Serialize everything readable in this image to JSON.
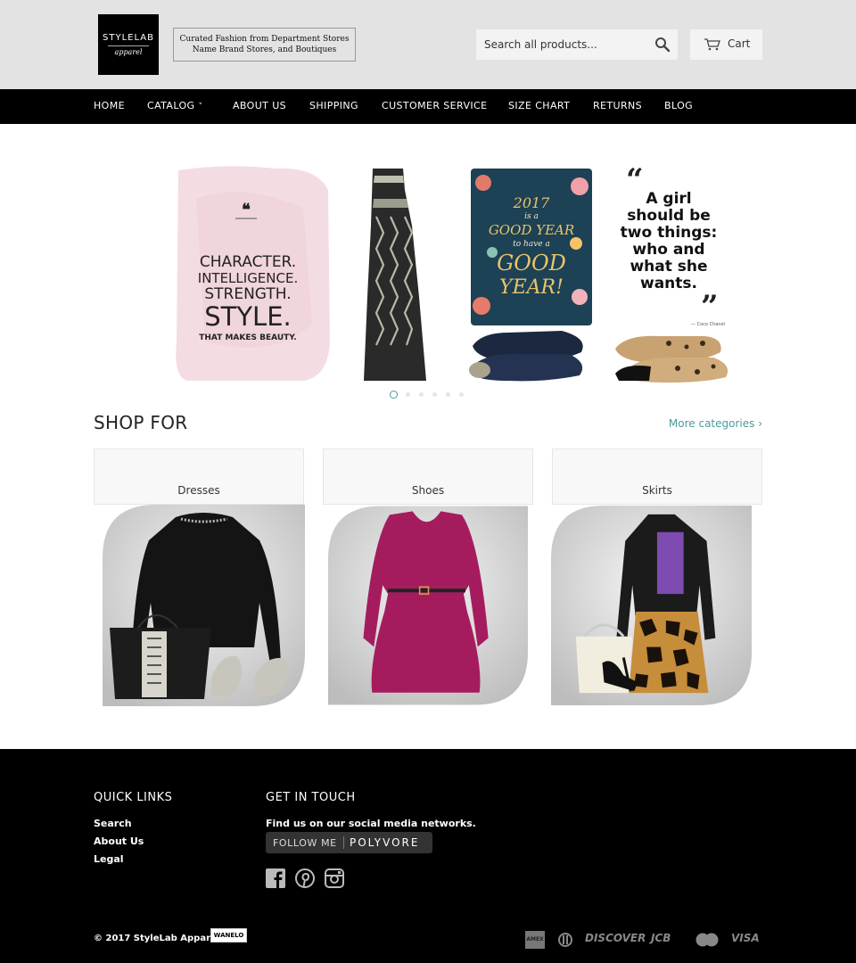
{
  "header": {
    "logo": {
      "line1": "STYLELAB",
      "line2": "apparel"
    },
    "tagline": {
      "line1": "Curated Fashion from Department Stores",
      "line2": "Name Brand Stores, and Boutiques"
    },
    "search": {
      "placeholder": "Search all products..."
    },
    "cart_label": "Cart"
  },
  "nav": {
    "items": [
      {
        "label": "HOME"
      },
      {
        "label": "CATALOG",
        "has_dropdown": true
      },
      {
        "label": "ABOUT US"
      },
      {
        "label": "SHIPPING"
      },
      {
        "label": "CUSTOMER SERVICE"
      },
      {
        "label": "SIZE CHART"
      },
      {
        "label": "RETURNS"
      },
      {
        "label": "BLOG"
      }
    ],
    "chevron": "˅"
  },
  "slider": {
    "panel1": {
      "quote_mark": "❝",
      "lines": [
        "CHARACTER.",
        "INTELLIGENCE.",
        "STRENGTH.",
        "STYLE.",
        "THAT MAKES BEAUTY."
      ]
    },
    "panel3": {
      "lines": [
        "2017",
        "is a",
        "GOOD YEAR",
        "to have a",
        "GOOD",
        "YEAR!"
      ]
    },
    "panel4": {
      "quote": [
        "A girl",
        "should be",
        "two things:",
        "who and",
        "what she",
        "wants."
      ],
      "attribution": "— Coco Chanel"
    },
    "dots_total": 6,
    "active_index": 0
  },
  "shop": {
    "title": "SHOP FOR",
    "more_link": "More categories ›",
    "categories": [
      {
        "label": "Dresses"
      },
      {
        "label": "Shoes"
      },
      {
        "label": "Skirts"
      }
    ]
  },
  "footer": {
    "quick_links_title": "QUICK LINKS",
    "quick_links": [
      "Search",
      "About Us",
      "Legal"
    ],
    "get_in_touch_title": "GET IN TOUCH",
    "social_text": "Find us on our social media networks.",
    "follow_label": "FOLLOW ME",
    "follow_brand": "POLYVORE",
    "social_icons": [
      "facebook-icon",
      "pinterest-icon",
      "instagram-icon"
    ],
    "copyright": "© 2017 StyleLab Apparel",
    "wanelo_badge": "WANELO",
    "payments": [
      "AMEX",
      "DINERS",
      "DISCOVER",
      "JCB",
      "MasterCard",
      "VISA"
    ]
  },
  "colors": {
    "header_bg": "#e3e3e3",
    "nav_bg": "#000000",
    "accent": "#4b9b9b",
    "footer_bg": "#000000"
  }
}
